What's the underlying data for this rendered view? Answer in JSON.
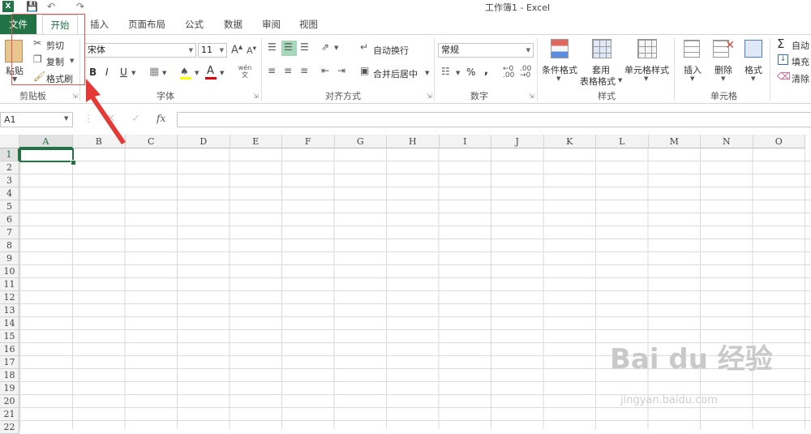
{
  "window": {
    "title": "工作簿1 - Excel"
  },
  "tabs": [
    {
      "label": "文件"
    },
    {
      "label": "开始"
    },
    {
      "label": "插入"
    },
    {
      "label": "页面布局"
    },
    {
      "label": "公式"
    },
    {
      "label": "数据"
    },
    {
      "label": "审阅"
    },
    {
      "label": "视图"
    }
  ],
  "clipboard": {
    "paste": "粘贴",
    "cut": "剪切",
    "copy": "复制",
    "format_painter": "格式刷",
    "label": "剪贴板"
  },
  "font": {
    "name": "宋体",
    "size": "11",
    "label": "字体",
    "bold": "B",
    "italic": "I",
    "underline": "U",
    "phonetic": "wén 文"
  },
  "alignment": {
    "wrap": "自动换行",
    "merge": "合并后居中",
    "label": "对齐方式"
  },
  "number": {
    "format": "常规",
    "label": "数字",
    "percent": "%",
    "comma": ","
  },
  "styles": {
    "conditional": "条件格式",
    "table_1": "套用",
    "table_2": "表格格式",
    "cell_styles": "单元格样式",
    "label": "样式"
  },
  "cells": {
    "insert": "插入",
    "delete": "删除",
    "format": "格式",
    "label": "单元格"
  },
  "editing": {
    "autosum": "自动",
    "fill": "填充",
    "clear": "清除"
  },
  "formula_bar": {
    "name_box": "A1",
    "fx": "fx"
  },
  "columns": [
    "A",
    "B",
    "C",
    "D",
    "E",
    "F",
    "G",
    "H",
    "I",
    "J",
    "K",
    "L",
    "M",
    "N",
    "O"
  ],
  "rows": [
    "1",
    "2",
    "3",
    "4",
    "5",
    "6",
    "7",
    "8",
    "9",
    "10",
    "11",
    "12",
    "13",
    "14",
    "15",
    "16",
    "17",
    "18",
    "19",
    "20",
    "21",
    "22"
  ],
  "watermark": {
    "text": "Bai du 经验",
    "sub": "jingyan.baidu.com"
  },
  "colors": {
    "accent": "#217346",
    "annotation": "#e05555"
  }
}
